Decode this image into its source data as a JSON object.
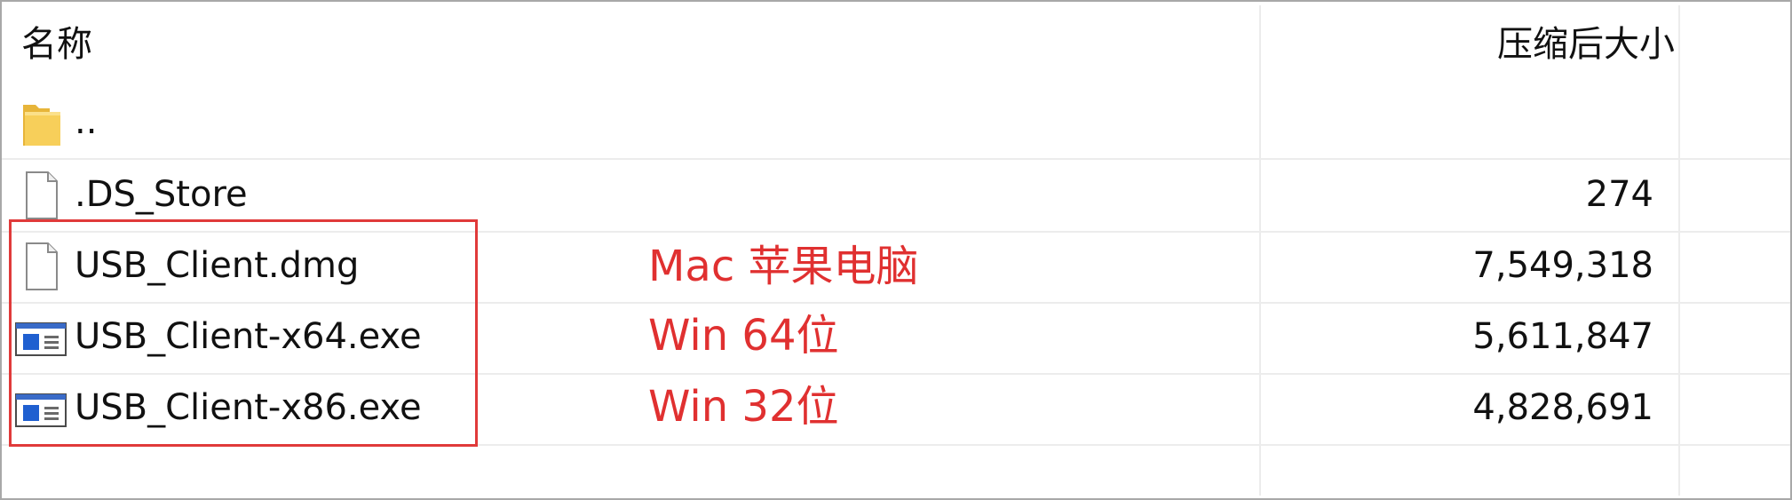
{
  "columns": {
    "name": "名称",
    "compressed_size": "压缩后大小"
  },
  "files": [
    {
      "name": "..",
      "size": "",
      "icon": "folder-icon"
    },
    {
      "name": ".DS_Store",
      "size": "274",
      "icon": "document-icon"
    },
    {
      "name": "USB_Client.dmg",
      "size": "7,549,318",
      "icon": "document-icon"
    },
    {
      "name": "USB_Client-x64.exe",
      "size": "5,611,847",
      "icon": "executable-icon"
    },
    {
      "name": "USB_Client-x86.exe",
      "size": "4,828,691",
      "icon": "executable-icon"
    }
  ],
  "annotations": {
    "mac": "Mac 苹果电脑",
    "win64": "Win 64位",
    "win32": "Win 32位"
  },
  "colors": {
    "annotation": "#e03030",
    "highlight_border": "#e03a3a",
    "folder": "#f7cf5a"
  }
}
